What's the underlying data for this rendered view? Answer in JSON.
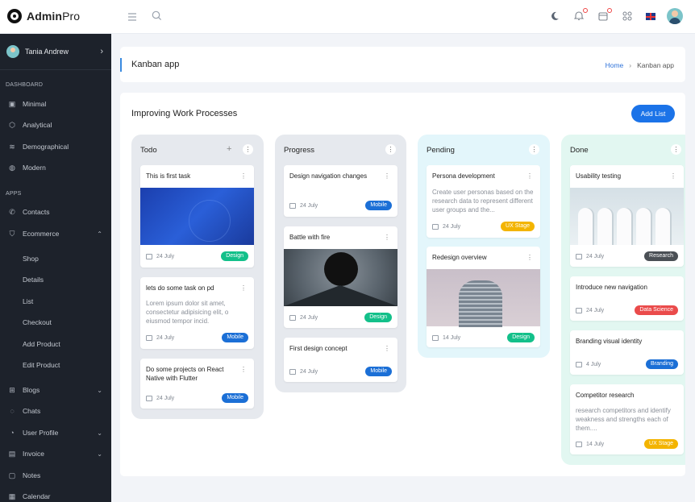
{
  "app": {
    "logo_bold": "Admin",
    "logo_light": "Pro"
  },
  "topbar": {
    "menu_icon": "menu-icon",
    "search_icon": "search-icon",
    "theme_icon": "moon-icon",
    "notif_icon": "bell-icon",
    "calendar_icon": "calendar-icon",
    "apps_icon": "apps-icon",
    "language_icon": "uk-flag-icon",
    "avatar_icon": "avatar-icon"
  },
  "sidebar": {
    "user_name": "Tania Andrew",
    "sections": {
      "dashboard": "DASHBOARD",
      "apps": "APPS"
    },
    "dashboard_items": [
      {
        "label": "Minimal",
        "icon": "grid-icon"
      },
      {
        "label": "Analytical",
        "icon": "shield-icon"
      },
      {
        "label": "Demographical",
        "icon": "layers-icon"
      },
      {
        "label": "Modern",
        "icon": "globe-icon"
      }
    ],
    "app_items": [
      {
        "label": "Contacts",
        "icon": "phone-icon"
      },
      {
        "label": "Ecommerce",
        "icon": "cart-icon"
      },
      {
        "label": "Shop"
      },
      {
        "label": "Details"
      },
      {
        "label": "List"
      },
      {
        "label": "Checkout"
      },
      {
        "label": "Add Product"
      },
      {
        "label": "Edit Product"
      },
      {
        "label": "Blogs",
        "icon": "blocks-icon"
      },
      {
        "label": "Chats",
        "icon": "chat-icon"
      },
      {
        "label": "User Profile",
        "icon": "user-icon"
      },
      {
        "label": "Invoice",
        "icon": "invoice-icon"
      },
      {
        "label": "Notes",
        "icon": "notes-icon"
      },
      {
        "label": "Calendar",
        "icon": "calendar-icon"
      }
    ]
  },
  "page": {
    "title": "Kanban app",
    "breadcrumb_home": "Home",
    "breadcrumb_current": "Kanban app"
  },
  "board": {
    "title": "Improving Work Processes",
    "add_list_label": "Add List",
    "columns": [
      {
        "title": "Todo",
        "bg": "#e6e9ee",
        "cards": [
          {
            "title": "This is first task",
            "date": "24 July",
            "badge": "Design",
            "badge_color": "#13c08a"
          },
          {
            "title": "lets do some task on pd",
            "desc": "Lorem ipsum dolor sit amet, consectetur adipisicing elit, o eiusmod tempor incid.",
            "date": "24 July",
            "badge": "Mobile",
            "badge_color": "#1b6fd6"
          },
          {
            "title": "Do some projects on React Native with Flutter",
            "date": "24 July",
            "badge": "Mobile",
            "badge_color": "#1b6fd6"
          }
        ]
      },
      {
        "title": "Progress",
        "bg": "#e6e9ee",
        "cards": [
          {
            "title": "Design navigation changes",
            "date": "24 July",
            "badge": "Mobile",
            "badge_color": "#1b6fd6"
          },
          {
            "title": "Battle with fire",
            "date": "24 July",
            "badge": "Design",
            "badge_color": "#13c08a"
          },
          {
            "title": "First design concept",
            "date": "24 July",
            "badge": "Mobile",
            "badge_color": "#1b6fd6"
          }
        ]
      },
      {
        "title": "Pending",
        "bg": "#e3f6fb",
        "cards": [
          {
            "title": "Persona development",
            "desc": "Create user personas based on the research data to represent different user groups and the...",
            "date": "24 July",
            "badge": "UX Stage",
            "badge_color": "#f3b400"
          },
          {
            "title": "Redesign overview",
            "date": "14 July",
            "badge": "Design",
            "badge_color": "#13c08a"
          }
        ]
      },
      {
        "title": "Done",
        "bg": "#e2f7f1",
        "cards": [
          {
            "title": "Usability testing",
            "date": "24 July",
            "badge": "Research",
            "badge_color": "#4a4f55"
          },
          {
            "title": "Introduce new navigation",
            "date": "24 July",
            "badge": "Data Science",
            "badge_color": "#ea4b4b"
          },
          {
            "title": "Branding visual identity",
            "date": "4 July",
            "badge": "Branding",
            "badge_color": "#1b6fd6"
          },
          {
            "title": "Competitor research",
            "desc": "research competitors and identify weakness and strengths each of them....",
            "date": "14 July",
            "badge": "UX Stage",
            "badge_color": "#f3b400"
          }
        ]
      }
    ]
  }
}
